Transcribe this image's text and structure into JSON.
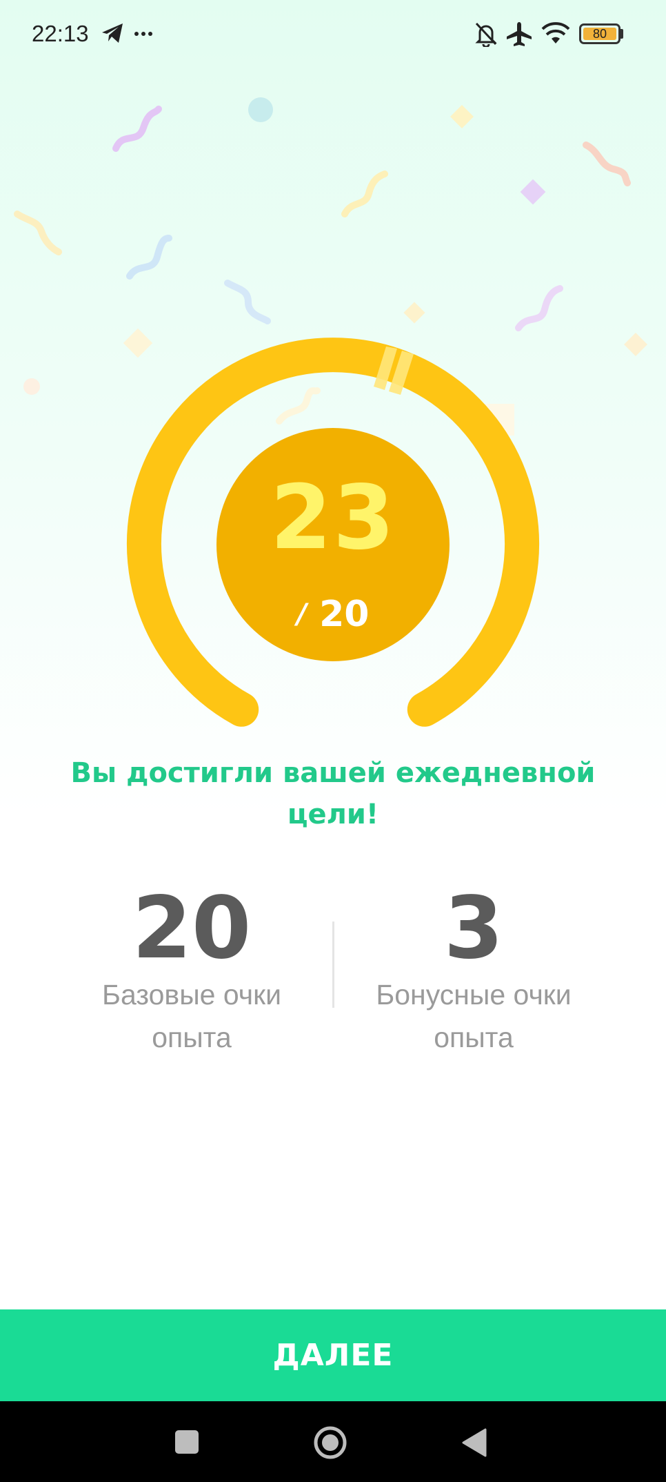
{
  "status_bar": {
    "time": "22:13",
    "battery_level": "80",
    "icons": [
      "telegram-icon",
      "more-dots-icon",
      "bell-off-icon",
      "airplane-icon",
      "wifi-icon",
      "battery-icon"
    ]
  },
  "progress": {
    "earned_xp": "23",
    "goal_xp": "20",
    "slash": "/",
    "ring_fraction": 1.0
  },
  "message": "Вы достигли вашей ежедневной цели!",
  "stats": {
    "base": {
      "value": "20",
      "label": "Базовые очки опыта"
    },
    "bonus": {
      "value": "3",
      "label": "Бонусные очки опыта"
    }
  },
  "next_button": {
    "label": "ДАЛЕЕ"
  },
  "nav": {
    "icons": [
      "recent-apps-icon",
      "home-icon",
      "back-icon"
    ]
  },
  "colors": {
    "ring": "#fec514",
    "center": "#f2b000",
    "number": "#fff46a",
    "accent_green": "#1adb95",
    "message_green": "#22c98a",
    "stat_value": "#5b5b5b",
    "stat_label": "#9a9a9a"
  }
}
